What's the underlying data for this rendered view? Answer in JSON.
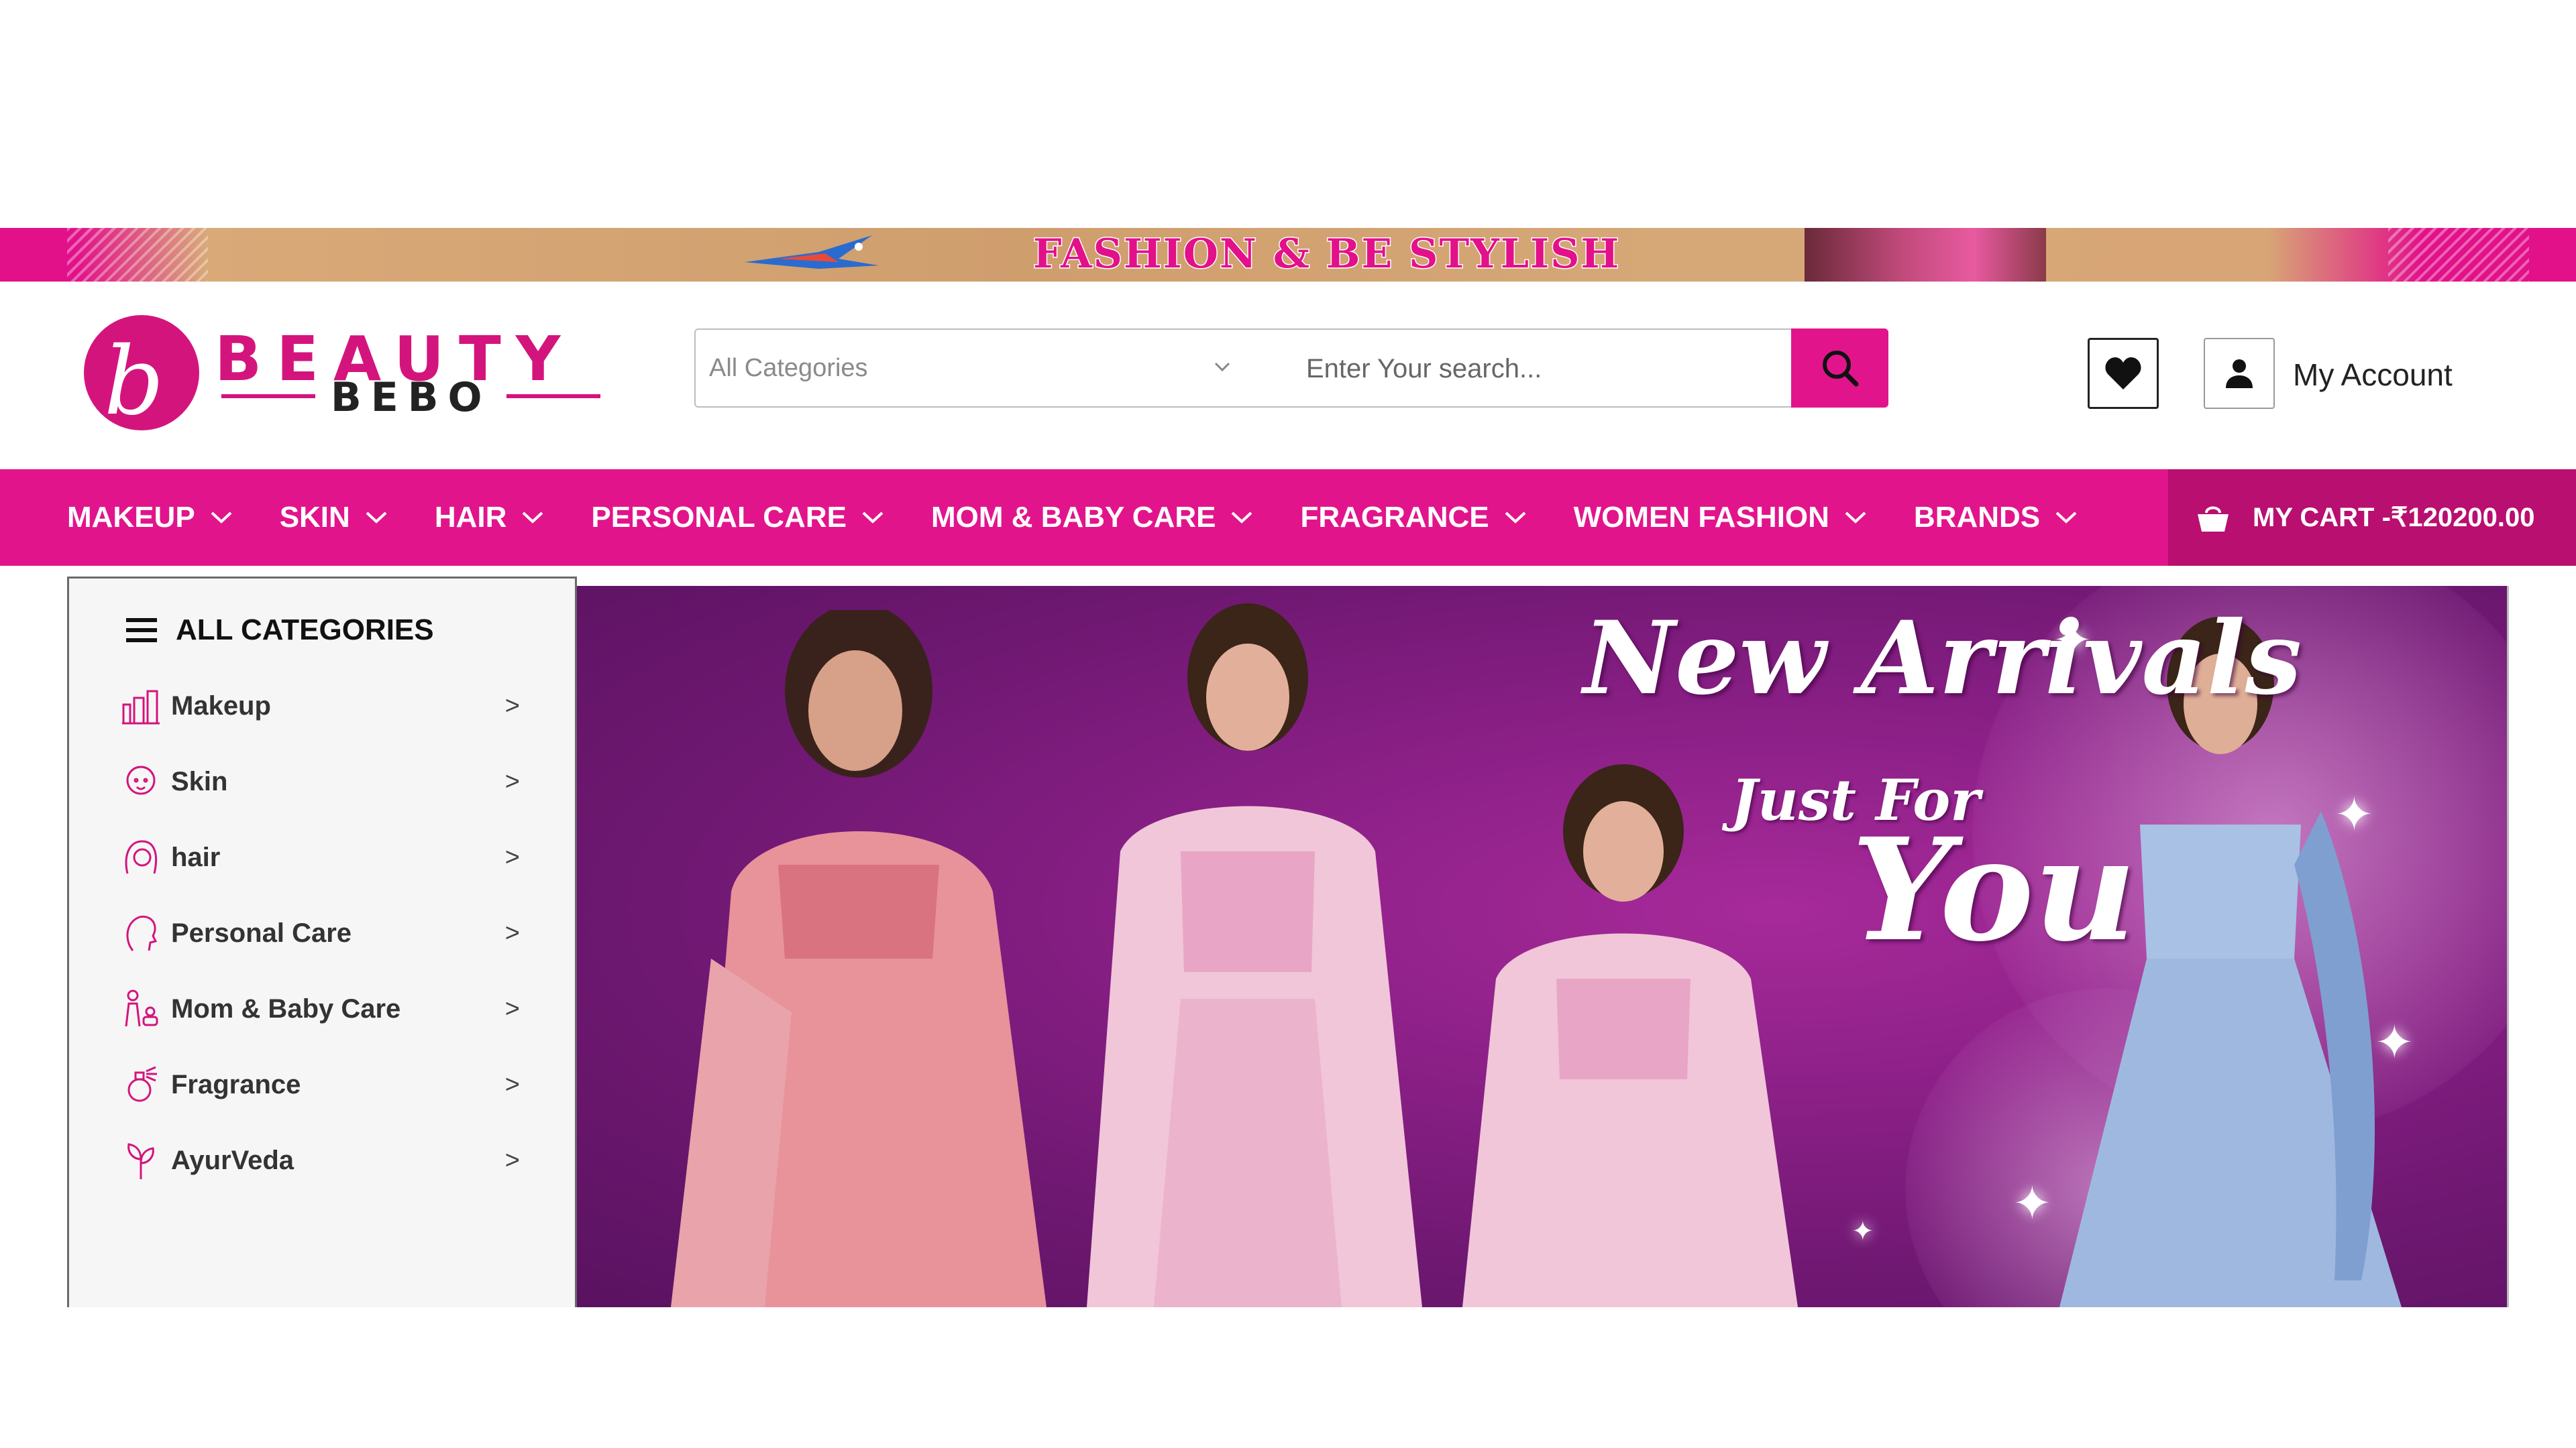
{
  "promo": {
    "headline": "FASHION & BE STYLISH"
  },
  "logo": {
    "mark": "b",
    "brand_top": "BEAUTY",
    "brand_bottom": "BEBO"
  },
  "search": {
    "category": "All Categories",
    "placeholder": "Enter Your search..."
  },
  "account": {
    "label": "My Account"
  },
  "nav": {
    "items": [
      {
        "label": "MAKEUP"
      },
      {
        "label": "SKIN"
      },
      {
        "label": "HAIR"
      },
      {
        "label": "PERSONAL CARE"
      },
      {
        "label": "MOM & BABY CARE"
      },
      {
        "label": "FRAGRANCE"
      },
      {
        "label": "WOMEN FASHION"
      },
      {
        "label": "BRANDS"
      }
    ],
    "cart_label": "MY CART -₹120200.00"
  },
  "sidebar": {
    "title": "ALL CATEGORIES",
    "arrow": ">",
    "items": [
      {
        "label": "Makeup",
        "icon": "makeup-icon"
      },
      {
        "label": "Skin",
        "icon": "skin-icon"
      },
      {
        "label": "hair",
        "icon": "hair-icon"
      },
      {
        "label": "Personal Care",
        "icon": "personal-care-icon"
      },
      {
        "label": "Mom & Baby Care",
        "icon": "mom-baby-icon"
      },
      {
        "label": "Fragrance",
        "icon": "fragrance-icon"
      },
      {
        "label": "AyurVeda",
        "icon": "ayurveda-icon"
      }
    ]
  },
  "hero": {
    "title": "New Arrivals",
    "line2": "Just For",
    "line3": "You"
  },
  "colors": {
    "brand_pink": "#e2148c",
    "cart_dark": "#b80f70",
    "hero_purple": "#8a1f86"
  }
}
